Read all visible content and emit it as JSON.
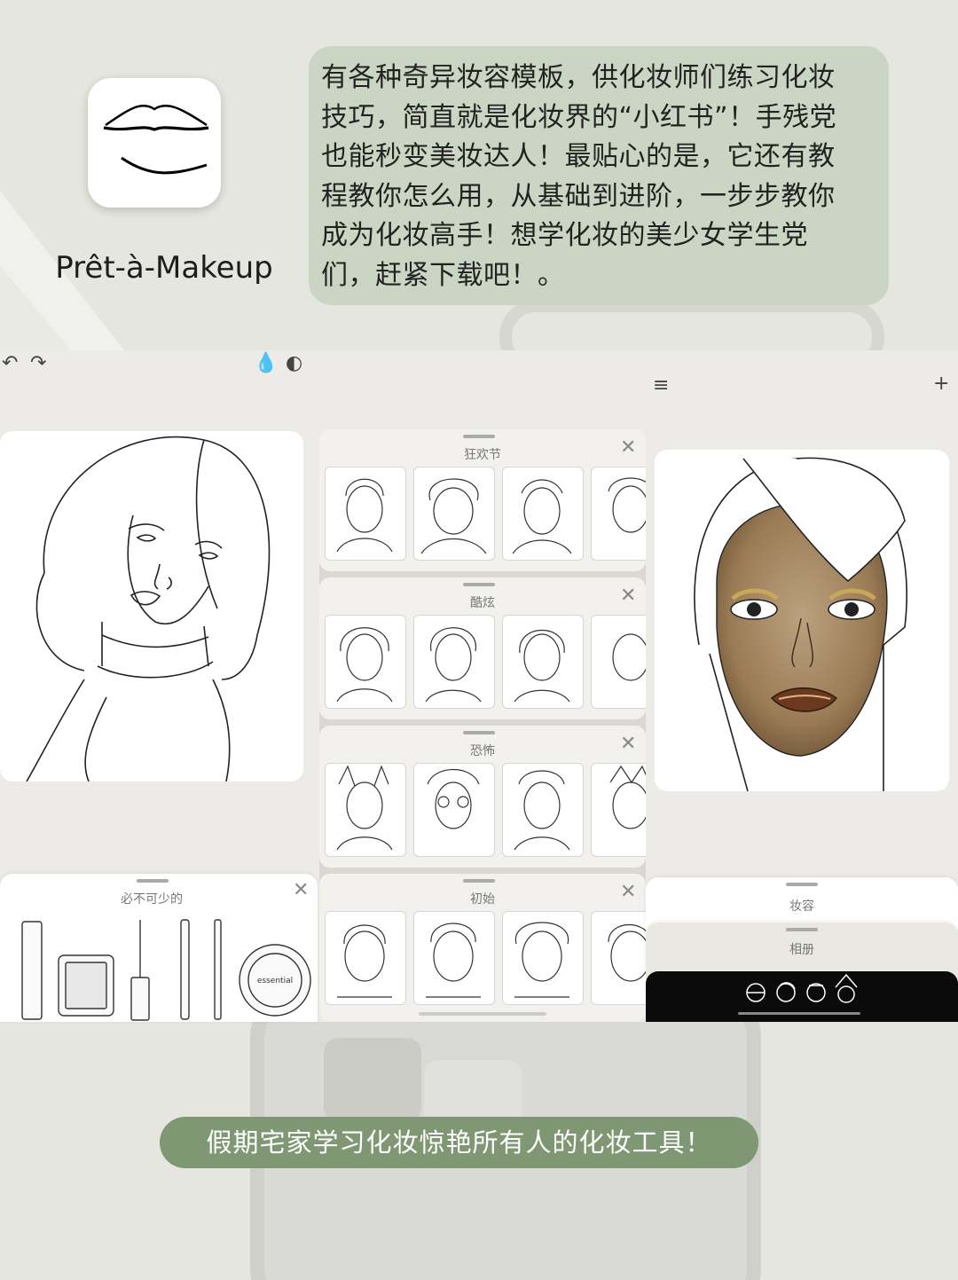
{
  "app": {
    "name": "Prêt-à-Makeup",
    "intro": "有各种奇异妆容模板，供化妆师们练习化妆技巧，简直就是化妆界的“小红书”！手残党也能秒变美妆达人！最贴心的是，它还有教程教你怎么用，从基础到进阶，一步步教你成为化妆高手！想学化妆的美少女学生党们，赶紧下载吧！。"
  },
  "toolbar": {
    "undo_icon": "undo-icon",
    "redo_icon": "redo-icon",
    "drop_icon": "drop-icon",
    "split_icon": "split-icon",
    "menu_icon": "menu-icon",
    "add_icon": "plus-icon"
  },
  "essentials_sheet": {
    "title": "必不可少的",
    "product_label": "essential"
  },
  "template_categories": [
    {
      "title": "狂欢节"
    },
    {
      "title": "酷炫"
    },
    {
      "title": "恐怖"
    },
    {
      "title": "初始"
    }
  ],
  "right_sheets": {
    "looks": "妆容",
    "album": "相册"
  },
  "footer": {
    "caption": "假期宅家学习化妆惊艳所有人的化妆工具！"
  },
  "colors": {
    "background": "#e4e6df",
    "bubble": "#cad6c3",
    "accent": "#7f9873"
  }
}
